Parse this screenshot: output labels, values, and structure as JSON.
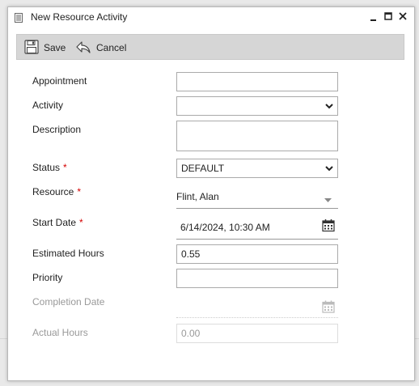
{
  "window": {
    "title": "New Resource Activity"
  },
  "toolbar": {
    "save_label": "Save",
    "cancel_label": "Cancel"
  },
  "form": {
    "appointment": {
      "label": "Appointment",
      "value": ""
    },
    "activity": {
      "label": "Activity",
      "value": ""
    },
    "description": {
      "label": "Description",
      "value": ""
    },
    "status": {
      "label": "Status",
      "required": "*",
      "value": "DEFAULT"
    },
    "resource": {
      "label": "Resource",
      "required": "*",
      "value": "Flint, Alan"
    },
    "start_date": {
      "label": "Start Date",
      "required": "*",
      "value": "6/14/2024, 10:30 AM"
    },
    "estimated_hours": {
      "label": "Estimated Hours",
      "value": "0.55"
    },
    "priority": {
      "label": "Priority",
      "value": ""
    },
    "completion_date": {
      "label": "Completion Date",
      "value": ""
    },
    "actual_hours": {
      "label": "Actual Hours",
      "value": "0.00"
    }
  },
  "colors": {
    "required": "#d40000",
    "toolbar_bg": "#d6d6d6"
  },
  "icons": [
    "window-icon",
    "minimize-icon",
    "maximize-icon",
    "close-icon",
    "save-icon",
    "undo-icon",
    "chevron-down-icon",
    "calendar-icon"
  ]
}
